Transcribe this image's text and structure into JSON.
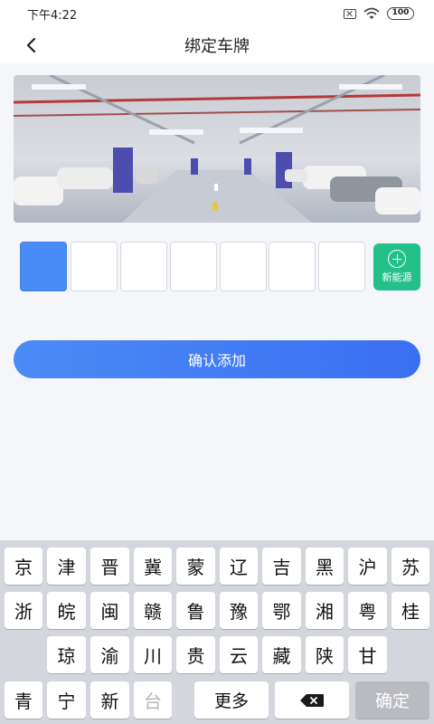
{
  "status_bar": {
    "time": "下午4:22",
    "battery": "100",
    "icons": [
      "sim-off-icon",
      "wifi-icon",
      "battery-icon"
    ]
  },
  "nav": {
    "back_icon": "chevron-left-icon",
    "title": "绑定车牌"
  },
  "banner": {
    "image": "parking-garage-photo"
  },
  "plate": {
    "cells": [
      "",
      "",
      "",
      "",
      "",
      "",
      ""
    ],
    "active_index": 0,
    "new_energy_label": "新能源",
    "new_energy_icon": "plus-circle-icon"
  },
  "confirm_button": {
    "label": "确认添加"
  },
  "keyboard": {
    "row1": [
      "京",
      "津",
      "晋",
      "冀",
      "蒙",
      "辽",
      "吉",
      "黑",
      "沪",
      "苏"
    ],
    "row2": [
      "浙",
      "皖",
      "闽",
      "赣",
      "鲁",
      "豫",
      "鄂",
      "湘",
      "粤",
      "桂"
    ],
    "row3": [
      "琼",
      "渝",
      "川",
      "贵",
      "云",
      "藏",
      "陕",
      "甘"
    ],
    "row4": [
      "青",
      "宁",
      "新",
      "台"
    ],
    "more_label": "更多",
    "delete_icon": "backspace-icon",
    "confirm_label": "确定"
  },
  "colors": {
    "accent": "#4a8cf7",
    "new_energy": "#23c08a",
    "keyboard_bg": "#d4d6dd"
  }
}
